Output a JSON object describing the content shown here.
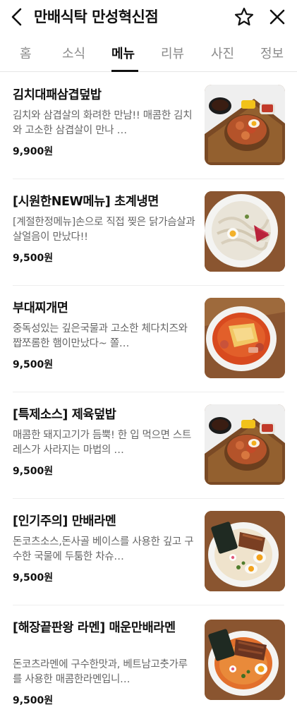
{
  "header": {
    "title": "만배식탁 만성혁신점"
  },
  "tabs": [
    {
      "label": "홈",
      "active": false
    },
    {
      "label": "소식",
      "active": false
    },
    {
      "label": "메뉴",
      "active": true
    },
    {
      "label": "리뷰",
      "active": false
    },
    {
      "label": "사진",
      "active": false
    },
    {
      "label": "정보",
      "active": false
    }
  ],
  "menu": {
    "items": [
      {
        "name": "김치대패삼겹덮밥",
        "description": "김치와 삼겹살의 화려한 만남!! 매콤한 김치와 고소한 삼겹살이 만나 …",
        "price": "9,900원",
        "photo": "rice-bowl-photo"
      },
      {
        "name": "[시원한NEW메뉴] 초계냉면",
        "description": "[계절한정메뉴]손으로 직접 찢은 닭가슴살과 살얼음이 만났다!!",
        "price": "9,500원",
        "photo": "cold-noodle-photo"
      },
      {
        "name": "부대찌개면",
        "description": "중독성있는 깊은국물과 고소한 체다치즈와 짭쪼롬한 햄이만났다~ 쫄…",
        "price": "9,500원",
        "photo": "budae-stew-photo"
      },
      {
        "name": "[특제소스] 제육덮밥",
        "description": "매콤한 돼지고기가 듬뿍! 한 입 먹으면 스트레스가 사라지는 마법의 …",
        "price": "9,500원",
        "photo": "rice-bowl-photo"
      },
      {
        "name": "[인기주의] 만배라멘",
        "description": "돈코츠소스,돈사골 베이스를 사용한 깊고 구수한 국물에 두툼한 차슈…",
        "price": "9,500원",
        "photo": "tonkotsu-ramen-photo"
      },
      {
        "name": "[해장끝판왕 라멘] 매운만배라멘",
        "description": "돈코츠라멘에 구수한맛과, 베트남고춧가루를 사용한 매콤한라멘입니…",
        "price": "9,500원",
        "photo": "spicy-ramen-photo"
      }
    ]
  }
}
